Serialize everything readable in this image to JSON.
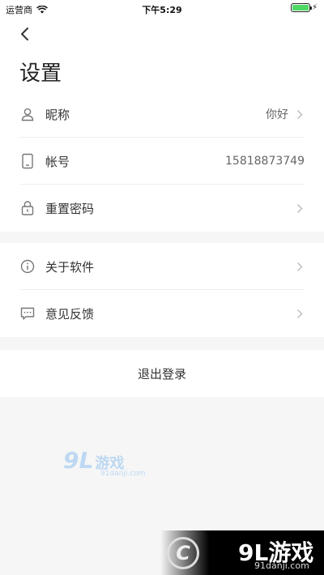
{
  "status_bar": {
    "carrier": "运营商",
    "time": "下午5:29",
    "battery_level": 1.0
  },
  "header": {
    "title": "设置"
  },
  "account_section": {
    "items": [
      {
        "icon": "user-icon",
        "label": "昵称",
        "value": "你好",
        "has_chevron": true
      },
      {
        "icon": "phone-icon",
        "label": "帐号",
        "value": "15818873749",
        "has_chevron": false
      },
      {
        "icon": "lock-icon",
        "label": "重置密码",
        "value": "",
        "has_chevron": true
      }
    ]
  },
  "about_section": {
    "items": [
      {
        "icon": "info-icon",
        "label": "关于软件",
        "has_chevron": true
      },
      {
        "icon": "feedback-icon",
        "label": "意见反馈",
        "has_chevron": true
      }
    ]
  },
  "logout": {
    "label": "退出登录"
  },
  "watermarks": {
    "left_logo": "9L",
    "left_text": "游戏",
    "left_url": "91danji.com",
    "right_mark": "C",
    "right_logo": "9L游戏",
    "right_url": "91danji.com"
  },
  "colors": {
    "background": "#f6f6f6",
    "card": "#ffffff",
    "text_primary": "#333333",
    "text_secondary": "#666666",
    "icon": "#777777",
    "battery": "#4cd964"
  }
}
